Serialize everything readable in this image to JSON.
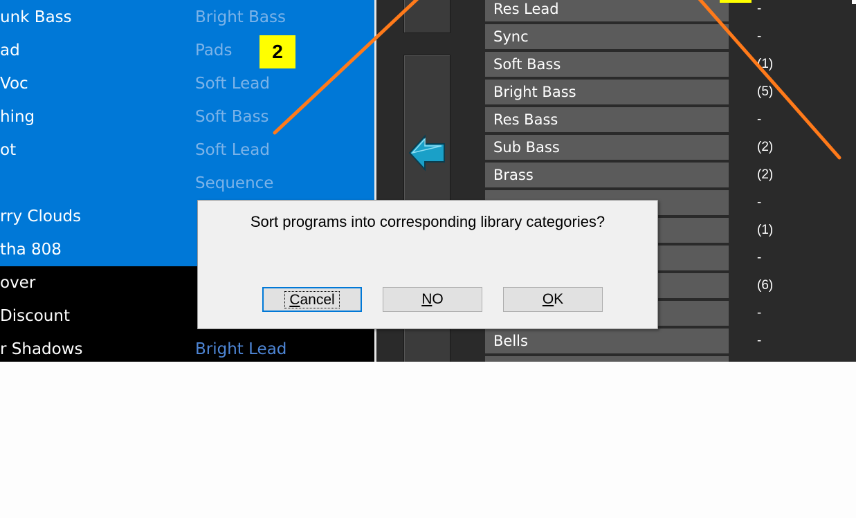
{
  "programs": [
    {
      "name": "unk Bass",
      "category": "Bright Bass",
      "selected": true
    },
    {
      "name": "ad",
      "category": "Pads",
      "selected": true
    },
    {
      "name": " Voc",
      "category": "Soft Lead",
      "selected": true
    },
    {
      "name": "hing",
      "category": "Soft Bass",
      "selected": true
    },
    {
      "name": "ot",
      "category": "Soft Lead",
      "selected": true
    },
    {
      "name": "",
      "category": "Sequence",
      "selected": true
    },
    {
      "name": "rry Clouds",
      "category": "",
      "selected": true
    },
    {
      "name": "tha 808",
      "category": "",
      "selected": true
    },
    {
      "name": "over",
      "category": "",
      "selected": false
    },
    {
      "name": " Discount",
      "category": "",
      "selected": false
    },
    {
      "name": "r Shadows",
      "category": "Bright Lead",
      "selected": false
    }
  ],
  "markers": {
    "left": "2"
  },
  "categories": [
    {
      "label": "Res Lead",
      "count": "-"
    },
    {
      "label": "Sync",
      "count": "-"
    },
    {
      "label": "Soft Bass",
      "count": "(1)"
    },
    {
      "label": "Bright Bass",
      "count": "(5)"
    },
    {
      "label": "Res Bass",
      "count": "-"
    },
    {
      "label": "Sub Bass",
      "count": "(2)"
    },
    {
      "label": "Brass",
      "count": "(2)"
    },
    {
      "label": "",
      "count": "-"
    },
    {
      "label": "",
      "count": "(1)"
    },
    {
      "label": "",
      "count": "-"
    },
    {
      "label": "",
      "count": "(6)"
    },
    {
      "label": "",
      "count": "-"
    },
    {
      "label": "Bells",
      "count": "-"
    }
  ],
  "dialog": {
    "message": "Sort programs into corresponding library categories?",
    "cancel_label": "Cancel",
    "no_label": "NO",
    "ok_label": "OK"
  },
  "colors": {
    "selection": "#0078d7",
    "annotation_line": "#ff7a1a",
    "marker": "#ffff00",
    "arrow": "#1aa0c8"
  }
}
